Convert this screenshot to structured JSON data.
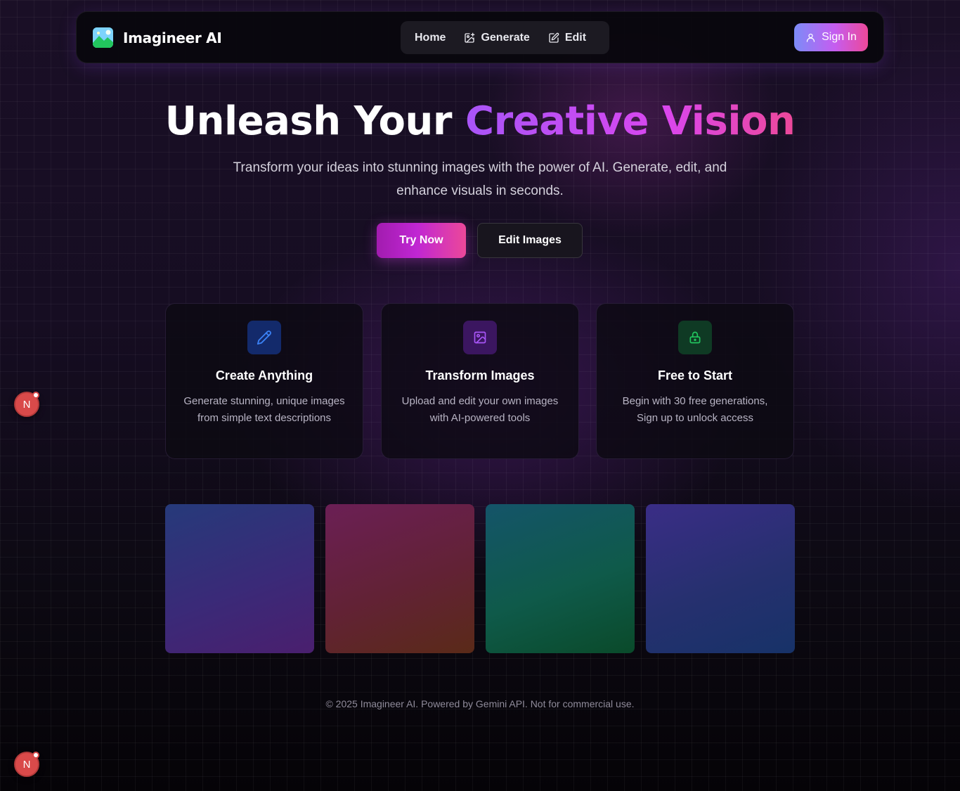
{
  "nav": {
    "brand": "Imagineer AI",
    "links": [
      {
        "label": "Home"
      },
      {
        "label": "Generate"
      },
      {
        "label": "Edit"
      }
    ],
    "signin_label": "Sign In"
  },
  "hero": {
    "title_main": "Unleash Your ",
    "title_accent": "Creative Vision",
    "subtitle": "Transform your ideas into stunning images with the power of AI. Generate, edit, and enhance visuals in seconds.",
    "primary_cta": "Try Now",
    "secondary_cta": "Edit Images"
  },
  "features": [
    {
      "icon": "pencil-icon",
      "title": "Create Anything",
      "description": "Generate stunning, unique images from simple text descriptions",
      "accent": "#3b82f6"
    },
    {
      "icon": "image-icon",
      "title": "Transform Images",
      "description": "Upload and edit your own images with AI-powered tools",
      "accent": "#a855f7"
    },
    {
      "icon": "lock-icon",
      "title": "Free to Start",
      "description": "Begin with 30 free generations, Sign up to unlock access",
      "accent": "#22c55e"
    }
  ],
  "footer": {
    "text": "© 2025 Imagineer AI. Powered by Gemini API. Not for commercial use."
  },
  "dev_badges": [
    {
      "label": "N"
    },
    {
      "label": "N"
    }
  ]
}
